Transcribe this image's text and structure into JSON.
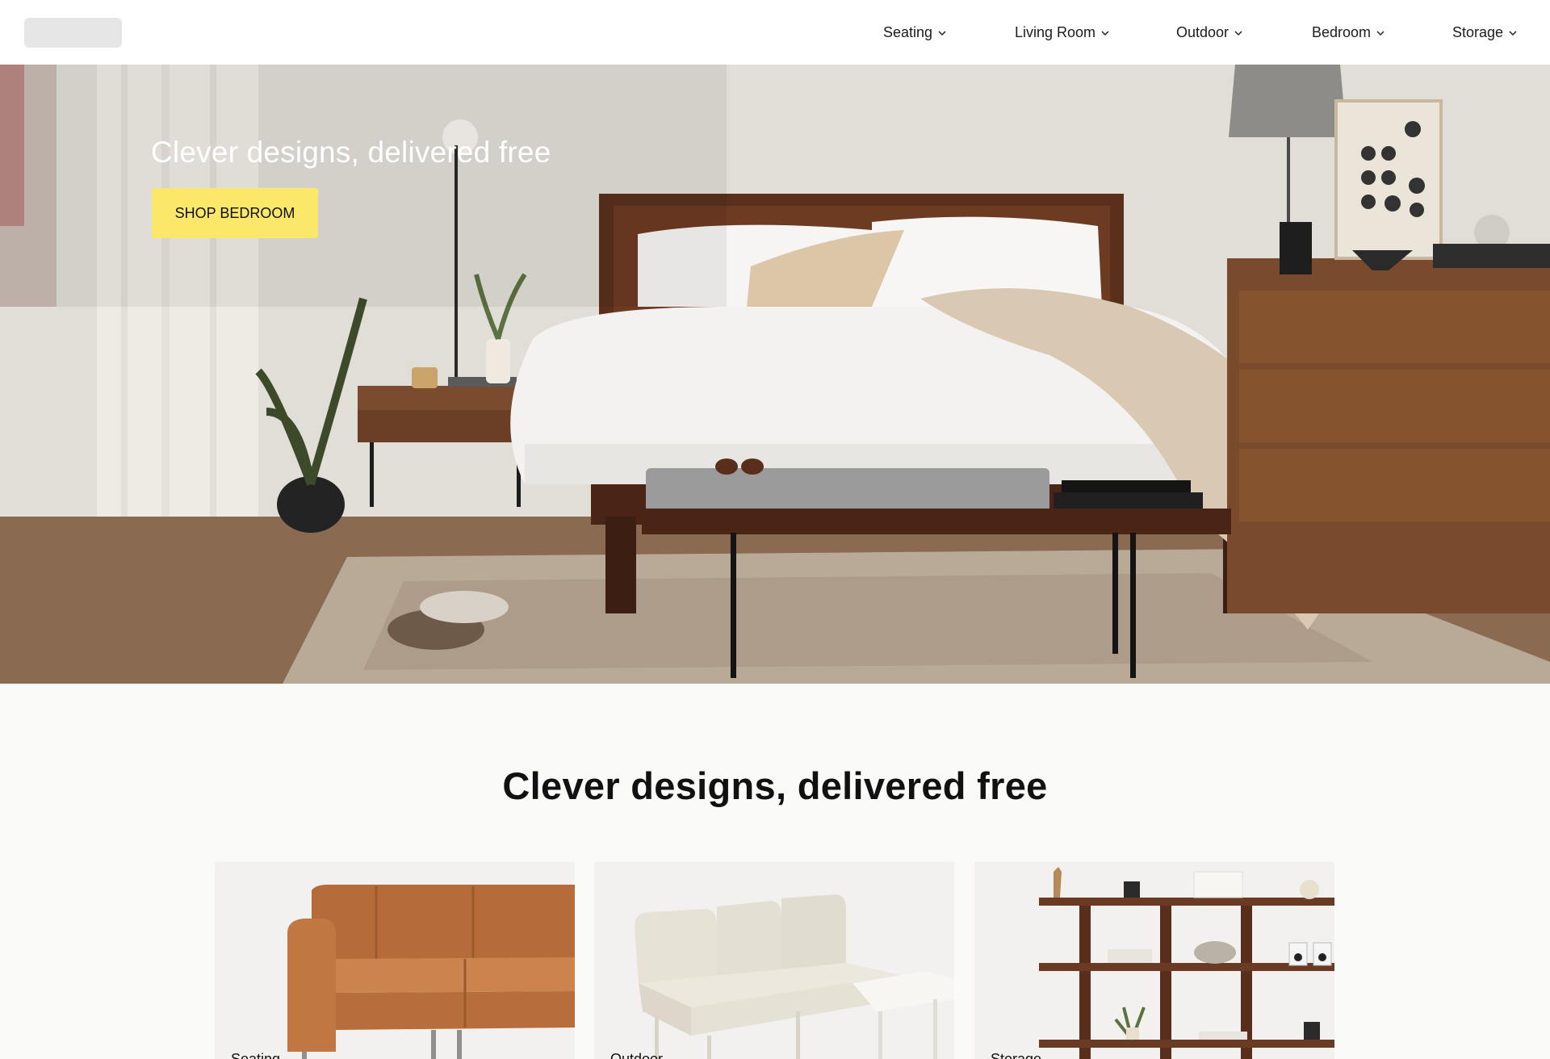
{
  "nav": {
    "items": [
      {
        "label": "Seating"
      },
      {
        "label": "Living Room"
      },
      {
        "label": "Outdoor"
      },
      {
        "label": "Bedroom"
      },
      {
        "label": "Storage"
      }
    ]
  },
  "hero": {
    "title": "Clever designs, delivered free",
    "button_label": "SHOP BEDROOM",
    "button_color": "#fbe86a"
  },
  "section": {
    "title": "Clever designs, delivered free",
    "cards": [
      {
        "label": "Seating",
        "image": "leather-sofa"
      },
      {
        "label": "Outdoor",
        "image": "outdoor-sofa"
      },
      {
        "label": "Storage",
        "image": "bookshelf"
      }
    ]
  }
}
